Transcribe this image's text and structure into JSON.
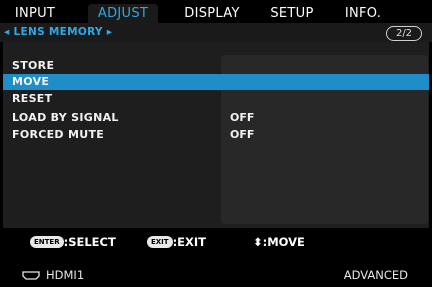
{
  "tabs": [
    "INPUT",
    "ADJUST",
    "DISPLAY",
    "SETUP",
    "INFO."
  ],
  "breadcrumb": {
    "prefix": "◂",
    "title": "LENS MEMORY",
    "suffix": "▸",
    "page": "2/2"
  },
  "menu": [
    {
      "label": "STORE",
      "value": ""
    },
    {
      "label": "MOVE",
      "value": ""
    },
    {
      "label": "RESET",
      "value": ""
    },
    {
      "label": "LOAD BY SIGNAL",
      "value": "OFF"
    },
    {
      "label": "FORCED MUTE",
      "value": "OFF"
    }
  ],
  "hints": {
    "enter_key": "ENTER",
    "enter_label": ":SELECT",
    "exit_key": "EXIT",
    "exit_label": ":EXIT",
    "move_glyph": "⬍",
    "move_label": ":MOVE"
  },
  "status": {
    "source": "HDMI1",
    "mode": "ADVANCED",
    "source_icon": "hdmi-connector-icon"
  },
  "colors": {
    "accent": "#2fa8e6",
    "selection": "#1f8ec8"
  }
}
